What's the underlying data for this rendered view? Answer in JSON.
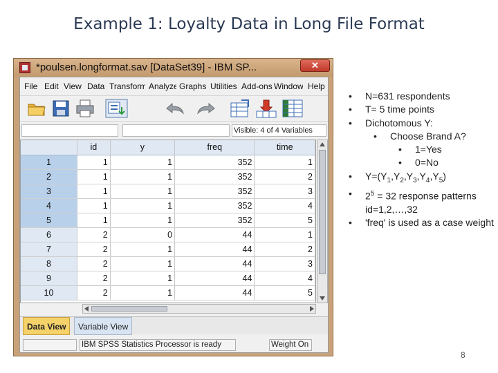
{
  "slide": {
    "title": "Example 1: Loyalty Data in Long File Format",
    "page_number": "8"
  },
  "window": {
    "title": "*poulsen.longformat.sav [DataSet39] - IBM SP...",
    "close_label": "✕"
  },
  "menu": [
    "File",
    "Edit",
    "View",
    "Data",
    "Transform",
    "Analyze",
    "Graphs",
    "Utilities",
    "Add-ons",
    "Window",
    "Help"
  ],
  "toolbar_icons": [
    "open-folder-icon",
    "save-icon",
    "print-icon",
    "dialog-recall-icon",
    "undo-icon",
    "redo-icon",
    "goto-case-icon",
    "goto-variable-icon",
    "variables-icon"
  ],
  "cellbar": {
    "visible_label": "Visible: 4 of 4 Variables"
  },
  "grid": {
    "columns": [
      "id",
      "y",
      "freq",
      "time"
    ],
    "rows": [
      {
        "row": "1",
        "id": "1",
        "y": "1",
        "freq": "352",
        "time": "1"
      },
      {
        "row": "2",
        "id": "1",
        "y": "1",
        "freq": "352",
        "time": "2"
      },
      {
        "row": "3",
        "id": "1",
        "y": "1",
        "freq": "352",
        "time": "3"
      },
      {
        "row": "4",
        "id": "1",
        "y": "1",
        "freq": "352",
        "time": "4"
      },
      {
        "row": "5",
        "id": "1",
        "y": "1",
        "freq": "352",
        "time": "5"
      },
      {
        "row": "6",
        "id": "2",
        "y": "0",
        "freq": "44",
        "time": "1"
      },
      {
        "row": "7",
        "id": "2",
        "y": "1",
        "freq": "44",
        "time": "2"
      },
      {
        "row": "8",
        "id": "2",
        "y": "1",
        "freq": "44",
        "time": "3"
      },
      {
        "row": "9",
        "id": "2",
        "y": "1",
        "freq": "44",
        "time": "4"
      },
      {
        "row": "10",
        "id": "2",
        "y": "1",
        "freq": "44",
        "time": "5"
      }
    ]
  },
  "tabs": {
    "data_view": "Data View",
    "variable_view": "Variable View"
  },
  "status": {
    "processor": "IBM SPSS Statistics Processor is ready",
    "weight": "Weight On"
  },
  "bullets": [
    {
      "level": 1,
      "parts": [
        [
          "t",
          "N=631 respondents"
        ]
      ]
    },
    {
      "level": 1,
      "parts": [
        [
          "t",
          "T= 5 time points"
        ]
      ]
    },
    {
      "level": 1,
      "parts": [
        [
          "t",
          "Dichotomous Y:"
        ]
      ]
    },
    {
      "level": 2,
      "parts": [
        [
          "t",
          "Choose Brand A?"
        ]
      ]
    },
    {
      "level": 3,
      "parts": [
        [
          "t",
          "1=Yes"
        ]
      ]
    },
    {
      "level": 3,
      "parts": [
        [
          "t",
          "0=No"
        ]
      ]
    },
    {
      "level": 1,
      "parts": [
        [
          "t",
          "Y=(Y"
        ],
        [
          "sub",
          "1"
        ],
        [
          "t",
          ",Y"
        ],
        [
          "sub",
          "2"
        ],
        [
          "t",
          ",Y"
        ],
        [
          "sub",
          "3"
        ],
        [
          "t",
          ",Y"
        ],
        [
          "sub",
          "4"
        ],
        [
          "t",
          ",Y"
        ],
        [
          "sub",
          "5"
        ],
        [
          "t",
          ")"
        ]
      ]
    },
    {
      "level": 1,
      "parts": [
        [
          "t",
          "2"
        ],
        [
          "sup",
          "5"
        ],
        [
          "t",
          " = 32 response patterns id=1,2,…,32"
        ]
      ]
    },
    {
      "level": 1,
      "parts": [
        [
          "t",
          "'freq' is used as a case weight"
        ]
      ]
    }
  ],
  "colors": {
    "window_frame": "#c9a27a",
    "active_tab": "#f5d26a",
    "header_fill": "#dfe8f3"
  }
}
